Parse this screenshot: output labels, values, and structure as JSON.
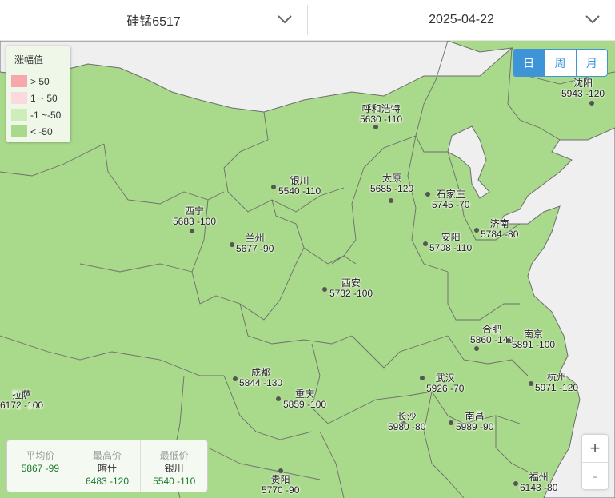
{
  "header": {
    "product": "硅锰6517",
    "date": "2025-04-22"
  },
  "legend": {
    "title": "涨幅值",
    "items": [
      {
        "label": "> 50",
        "color": "#f7a8ad"
      },
      {
        "label": "1 ~ 50",
        "color": "#fbd9dc"
      },
      {
        "label": "-1 ~-50",
        "color": "#cdeeb9"
      },
      {
        "label": "< -50",
        "color": "#a9d98a"
      }
    ]
  },
  "period_tabs": [
    "日",
    "周",
    "月"
  ],
  "map": {
    "land_color": "#a9d98a",
    "border_color": "#6d6d6d",
    "water_color": "#f0f0f0"
  },
  "cities": [
    {
      "name": "沈阳",
      "value": "5943 -120"
    },
    {
      "name": "呼和浩特",
      "value": "5630 -110"
    },
    {
      "name": "银川",
      "value": "5540 -110"
    },
    {
      "name": "太原",
      "value": "5685 -120"
    },
    {
      "name": "石家庄",
      "value": "5745 -70"
    },
    {
      "name": "西宁",
      "value": "5683 -100"
    },
    {
      "name": "兰州",
      "value": "5677 -90"
    },
    {
      "name": "济南",
      "value": "5784 -80"
    },
    {
      "name": "安阳",
      "value": "5708 -110"
    },
    {
      "name": "西安",
      "value": "5732 -100"
    },
    {
      "name": "合肥",
      "value": "5860 -140"
    },
    {
      "name": "南京",
      "value": "5891 -100"
    },
    {
      "name": "成都",
      "value": "5844 -130"
    },
    {
      "name": "武汉",
      "value": "5926 -70"
    },
    {
      "name": "杭州",
      "value": "5971 -120"
    },
    {
      "name": "拉萨",
      "value": "6172 -100"
    },
    {
      "name": "重庆",
      "value": "5859 -100"
    },
    {
      "name": "长沙",
      "value": "5980 -80"
    },
    {
      "name": "南昌",
      "value": "5989 -90"
    },
    {
      "name": "贵阳",
      "value": "5770 -90"
    },
    {
      "name": "福州",
      "value": "6143 -80"
    }
  ],
  "stats": {
    "avg": {
      "title": "平均价",
      "name": "",
      "value": "5867 -99"
    },
    "high": {
      "title": "最高价",
      "name": "喀什",
      "value": "6483 -120"
    },
    "low": {
      "title": "最低价",
      "name": "银川",
      "value": "5540 -110"
    }
  },
  "zoom": {
    "in": "+",
    "out": "-"
  }
}
